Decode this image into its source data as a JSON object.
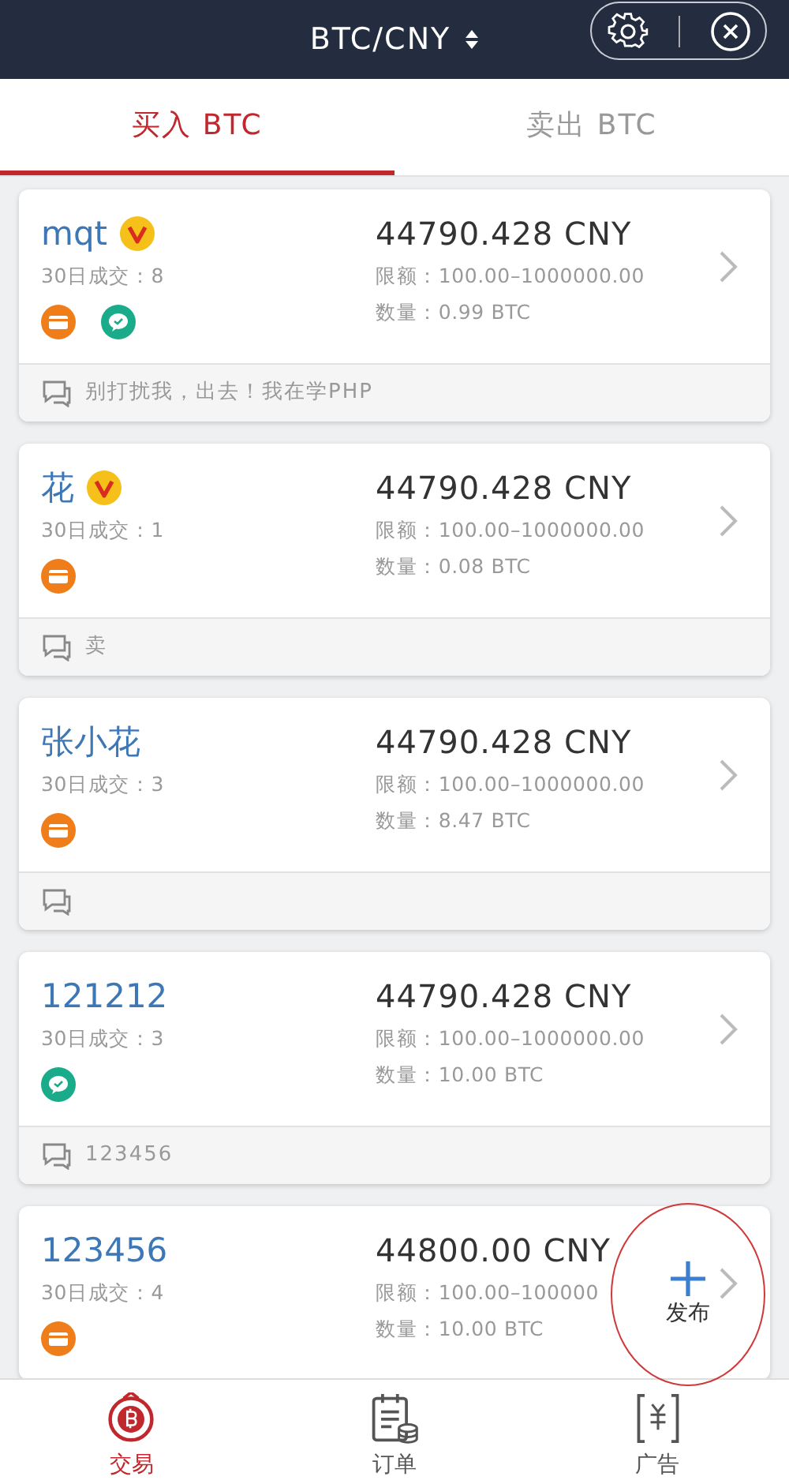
{
  "header": {
    "pair": "BTC/CNY"
  },
  "tabs": [
    {
      "label": "买入 BTC",
      "selected": true
    },
    {
      "label": "卖出 BTC",
      "selected": false
    }
  ],
  "offers": [
    {
      "name": "mqt",
      "vip": true,
      "trades": "30日成交：8",
      "payments": [
        {
          "kind": "bank"
        },
        {
          "kind": "wechat"
        }
      ],
      "price": "44790.428 CNY",
      "limit": "限额：100.00–1000000.00",
      "amount": "数量：0.99 BTC",
      "comment_bar": true,
      "message": "别打扰我，出去！我在学PHP"
    },
    {
      "name": "花",
      "vip": true,
      "trades": "30日成交：1",
      "payments": [
        {
          "kind": "bank"
        }
      ],
      "price": "44790.428 CNY",
      "limit": "限额：100.00–1000000.00",
      "amount": "数量：0.08 BTC",
      "comment_bar": true,
      "message": "卖"
    },
    {
      "name": "张小花",
      "vip": false,
      "trades": "30日成交：3",
      "payments": [
        {
          "kind": "bank"
        }
      ],
      "price": "44790.428 CNY",
      "limit": "限额：100.00–1000000.00",
      "amount": "数量：8.47 BTC",
      "comment_bar": true
    },
    {
      "name": "121212",
      "vip": false,
      "trades": "30日成交：3",
      "payments": [
        {
          "kind": "wechat"
        }
      ],
      "price": "44790.428 CNY",
      "limit": "限额：100.00–1000000.00",
      "amount": "数量：10.00 BTC",
      "comment_bar": true,
      "message": "123456"
    },
    {
      "name": "123456",
      "vip": false,
      "trades": "30日成交：4",
      "payments": [
        {
          "kind": "bank"
        }
      ],
      "price": "44800.00 CNY",
      "limit": "限额：100.00–100000",
      "amount": "数量：10.00 BTC",
      "comment_bar": false
    }
  ],
  "publish_button": {
    "label": "发布"
  },
  "bottom_nav": [
    {
      "kind": "trade",
      "label": "交易",
      "selected": true
    },
    {
      "kind": "orders",
      "label": "订单",
      "selected": false
    },
    {
      "kind": "ads",
      "label": "广告",
      "selected": false
    }
  ]
}
